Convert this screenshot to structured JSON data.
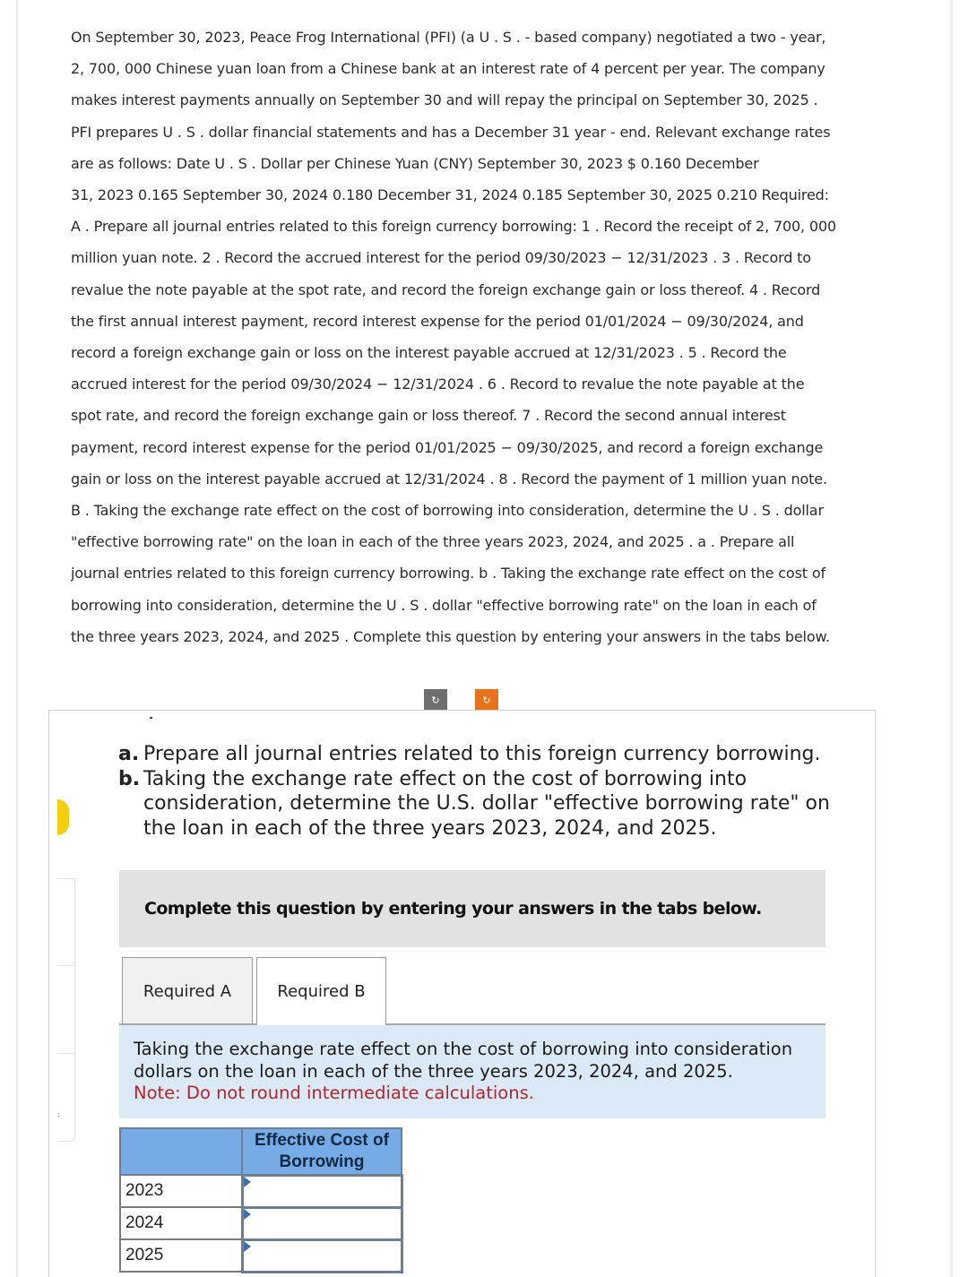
{
  "question": {
    "lines": [
      "On September 30, 2023, Peace Frog International (PFI) (a U . S . - based company) negotiated a two - year,",
      "2, 700, 000 Chinese yuan loan from a Chinese bank at an interest rate of 4 percent per year. The company",
      "makes interest payments annually on September 30 and will repay the principal on September 30, 2025 .",
      "PFI prepares U . S . dollar financial statements and has a December 31 year - end. Relevant exchange rates",
      "are as follows: Date U . S . Dollar per Chinese Yuan (CNY) September 30, 2023 $ 0.160 December",
      "31, 2023 0.165 September 30, 2024 0.180 December 31, 2024 0.185 September 30, 2025 0.210 Required:",
      "A . Prepare all journal entries related to this foreign currency borrowing: 1 . Record the receipt of 2, 700, 000",
      "million yuan note. 2 . Record the accrued interest for the period 09/30/2023 − 12/31/2023 . 3 . Record to",
      "revalue the note payable at the spot rate, and record the foreign exchange gain or loss thereof. 4 . Record",
      "the first annual interest payment, record interest expense for the period 01/01/2024 − 09/30/2024, and",
      "record a foreign exchange gain or loss on the interest payable accrued at 12/31/2023 . 5 . Record the",
      "accrued interest for the period 09/30/2024 − 12/31/2024 . 6 . Record to revalue the note payable at the",
      "spot rate, and record the foreign exchange gain or loss thereof. 7 . Record the second annual interest",
      "payment, record interest expense for the period 01/01/2025 − 09/30/2025, and record a foreign exchange",
      "gain or loss on the interest payable accrued at 12/31/2024 . 8 . Record the payment of 1 million yuan note.",
      "B . Taking the exchange rate effect on the cost of borrowing into consideration, determine the U . S . dollar",
      "\"effective borrowing rate\" on the loan in each of the three years 2023, 2024, and 2025 . a . Prepare all",
      "journal entries related to this foreign currency borrowing. b . Taking the exchange rate effect on the cost of",
      "borrowing into consideration, determine the U . S . dollar \"effective borrowing rate\" on the loan in each of",
      "the three years 2023, 2024, and 2025 . Complete this question by entering your answers in the tabs below."
    ]
  },
  "toolbar": {
    "undo_icon": "↻",
    "redo_icon": "↻"
  },
  "parts": [
    {
      "letter": "a.",
      "text": "Prepare all journal entries related to this foreign currency borrowing."
    },
    {
      "letter": "b.",
      "text": "Taking the exchange rate effect on the cost of borrowing into consideration, determine the U.S. dollar \"effective borrowing rate\" on the loan in each of the three years 2023, 2024, and 2025."
    }
  ],
  "instruction_bar": "Complete this question by entering your answers in the tabs below.",
  "tabs": [
    {
      "label": "Required A",
      "active": false
    },
    {
      "label": "Required B",
      "active": true
    }
  ],
  "required_b": {
    "line1": "Taking the exchange rate effect on the cost of borrowing into consideration",
    "line2": "dollars on the loan in each of the three years 2023, 2024, and 2025.",
    "note": "Note: Do not round intermediate calculations."
  },
  "answer_table": {
    "column_header": "Effective Cost of Borrowing",
    "rows": [
      {
        "year": "2023",
        "value": ""
      },
      {
        "year": "2024",
        "value": ""
      },
      {
        "year": "2025",
        "value": ""
      }
    ]
  },
  "side_marker": ";"
}
